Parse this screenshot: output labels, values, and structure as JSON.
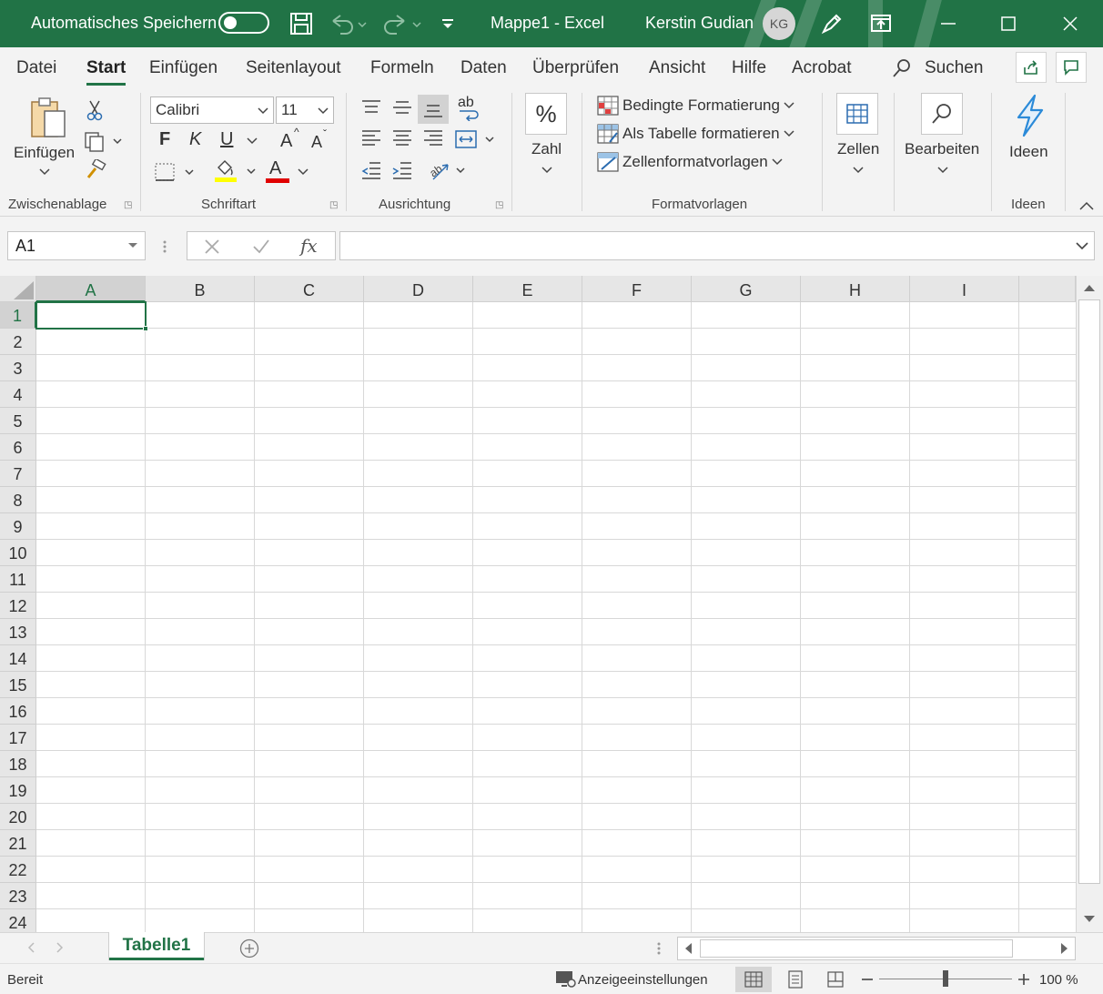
{
  "titlebar": {
    "autosave_label": "Automatisches Speichern",
    "doc_title": "Mappe1  -  Excel",
    "user_name": "Kerstin Gudian",
    "user_initials": "KG"
  },
  "tabs": [
    "Datei",
    "Start",
    "Einfügen",
    "Seitenlayout",
    "Formeln",
    "Daten",
    "Überprüfen",
    "Ansicht",
    "Hilfe",
    "Acrobat"
  ],
  "active_tab": "Start",
  "search": {
    "label": "Suchen"
  },
  "ribbon": {
    "clipboard": {
      "paste_label": "Einfügen",
      "group_label": "Zwischenablage"
    },
    "font": {
      "font_name": "Calibri",
      "font_size": "11",
      "bold": "F",
      "italic": "K",
      "underline": "U",
      "grow": "A",
      "shrink": "A",
      "color_letter": "A",
      "group_label": "Schriftart"
    },
    "alignment": {
      "wrap_label": "ab",
      "group_label": "Ausrichtung"
    },
    "number": {
      "symbol": "%",
      "label": "Zahl"
    },
    "styles": {
      "items": [
        "Bedingte Formatierung",
        "Als Tabelle formatieren",
        "Zellenformatvorlagen"
      ],
      "group_label": "Formatvorlagen"
    },
    "cells": {
      "label": "Zellen"
    },
    "editing": {
      "label": "Bearbeiten"
    },
    "ideas": {
      "label": "Ideen",
      "group_label": "Ideen"
    }
  },
  "formula_bar": {
    "name_box": "A1",
    "fx": "fx",
    "formula": ""
  },
  "grid": {
    "columns": [
      "A",
      "B",
      "C",
      "D",
      "E",
      "F",
      "G",
      "H",
      "I"
    ],
    "rows": [
      "1",
      "2",
      "3",
      "4",
      "5",
      "6",
      "7",
      "8",
      "9",
      "10",
      "11",
      "12",
      "13",
      "14",
      "15",
      "16",
      "17",
      "18",
      "19",
      "20",
      "21",
      "22",
      "23",
      "24"
    ],
    "selected_column": "A",
    "selected_row": "1"
  },
  "sheets": {
    "tabs": [
      "Tabelle1"
    ]
  },
  "statusbar": {
    "ready": "Bereit",
    "display_settings": "Anzeigeeinstellungen",
    "zoom": "100 %"
  },
  "colors": {
    "accent": "#217346",
    "highlight": "#ffff00",
    "font_color": "#e00000"
  }
}
